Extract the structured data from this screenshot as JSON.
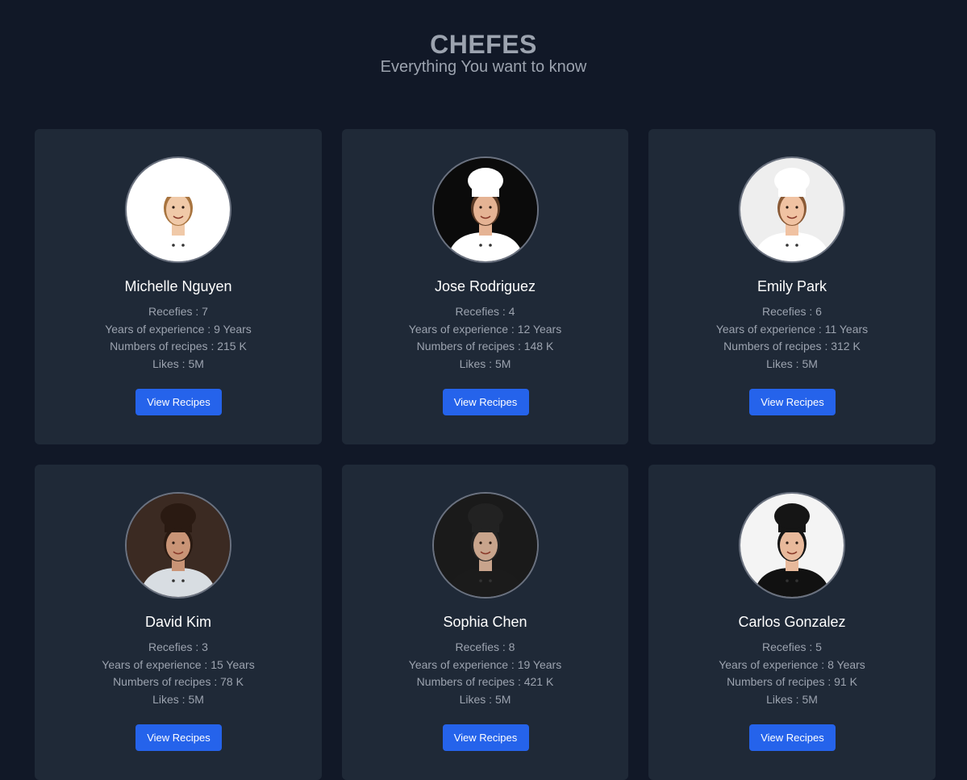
{
  "header": {
    "title": "CHEFES",
    "subtitle": "Everything You want to know"
  },
  "chefs": [
    {
      "name": "Michelle Nguyen",
      "recefies": "Recefies : 7",
      "experience": "Years of experience : 9 Years",
      "recipes": "Numbers of recipes : 215 K",
      "likes": "Likes : 5M",
      "button": "View Recipes",
      "bg": "#ffffff",
      "skin": "#f0c9a8",
      "hair": "#a8743f",
      "hat": "#ffffff",
      "coat": "#ffffff",
      "icon": "chef-portrait-icon"
    },
    {
      "name": "Jose Rodriguez",
      "recefies": "Recefies : 4",
      "experience": "Years of experience : 12 Years",
      "recipes": "Numbers of recipes : 148 K",
      "likes": "Likes : 5M",
      "button": "View Recipes",
      "bg": "#0b0b0b",
      "skin": "#e5b394",
      "hair": "#5a3a26",
      "hat": "#ffffff",
      "coat": "#ffffff",
      "icon": "chef-portrait-icon"
    },
    {
      "name": "Emily Park",
      "recefies": "Recefies : 6",
      "experience": "Years of experience : 11 Years",
      "recipes": "Numbers of recipes : 312 K",
      "likes": "Likes : 5M",
      "button": "View Recipes",
      "bg": "#eeeeee",
      "skin": "#f0c2a2",
      "hair": "#8a5a36",
      "hat": "#ffffff",
      "coat": "#ffffff",
      "icon": "chef-portrait-icon"
    },
    {
      "name": "David Kim",
      "recefies": "Recefies : 3",
      "experience": "Years of experience : 15 Years",
      "recipes": "Numbers of recipes : 78 K",
      "likes": "Likes : 5M",
      "button": "View Recipes",
      "bg": "#3b2a22",
      "skin": "#c99476",
      "hair": "#2a1a12",
      "hat": "#2a1a12",
      "coat": "#d8dde2",
      "icon": "chef-portrait-icon"
    },
    {
      "name": "Sophia Chen",
      "recefies": "Recefies : 8",
      "experience": "Years of experience : 19 Years",
      "recipes": "Numbers of recipes : 421 K",
      "likes": "Likes : 5M",
      "button": "View Recipes",
      "bg": "#1a1a1a",
      "skin": "#c8a48c",
      "hair": "#222222",
      "hat": "#222222",
      "coat": "#1b1b1b",
      "icon": "chef-portrait-icon"
    },
    {
      "name": "Carlos Gonzalez",
      "recefies": "Recefies : 5",
      "experience": "Years of experience : 8 Years",
      "recipes": "Numbers of recipes : 91 K",
      "likes": "Likes : 5M",
      "button": "View Recipes",
      "bg": "#f4f4f4",
      "skin": "#e8b99b",
      "hair": "#151515",
      "hat": "#151515",
      "coat": "#111111",
      "icon": "chef-portrait-icon"
    }
  ]
}
